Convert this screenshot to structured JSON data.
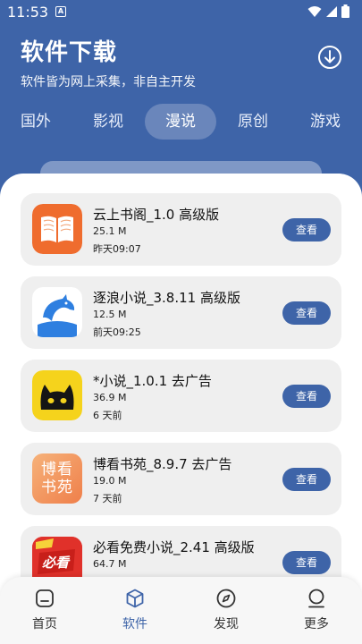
{
  "status": {
    "time": "11:53",
    "notification": "A"
  },
  "header": {
    "title": "软件下载",
    "subtitle": "软件皆为网上采集，非自主开发"
  },
  "tabs": [
    {
      "label": "国外"
    },
    {
      "label": "影视"
    },
    {
      "label": "漫说"
    },
    {
      "label": "原创"
    },
    {
      "label": "游戏"
    }
  ],
  "active_tab": "漫说",
  "apps": [
    {
      "name": "云上书阁_1.0 高级版",
      "size": "25.1 M",
      "time": "昨天09:07",
      "button": "查看",
      "icon": "open-book-icon"
    },
    {
      "name": "逐浪小说_3.8.11 高级版",
      "size": "12.5 M",
      "time": "前天09:25",
      "button": "查看",
      "icon": "dolphin-icon"
    },
    {
      "name": "*小说_1.0.1 去广告",
      "size": "36.9 M",
      "time": "6 天前",
      "button": "查看",
      "icon": "black-cat-icon"
    },
    {
      "name": "博看书苑_8.9.7 去广告",
      "size": "19.0 M",
      "time": "7 天前",
      "button": "查看",
      "icon": "bokan-logo-icon",
      "icon_text": "博看书苑"
    },
    {
      "name": "必看免费小说_2.41 高级版",
      "size": "64.7 M",
      "time": "",
      "button": "查看",
      "icon": "bikan-logo-icon",
      "icon_text": "必看"
    }
  ],
  "nav": [
    {
      "label": "首页",
      "icon": "home-icon"
    },
    {
      "label": "软件",
      "icon": "cube-icon"
    },
    {
      "label": "发现",
      "icon": "compass-icon"
    },
    {
      "label": "更多",
      "icon": "person-icon"
    }
  ],
  "colors": {
    "primary": "#3e64a8",
    "card": "#efefef",
    "tab_active": "#6a86bb"
  }
}
